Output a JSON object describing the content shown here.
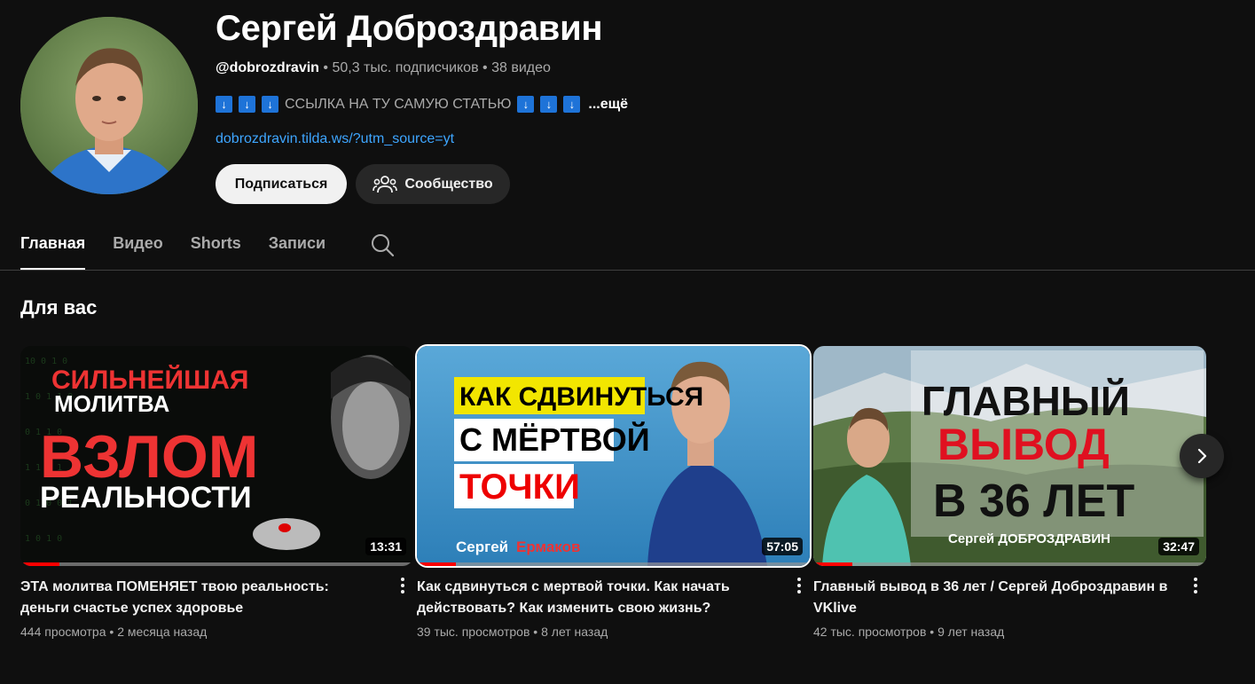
{
  "channel": {
    "name": "Сергей Доброздравин",
    "handle": "@dobrozdravin",
    "subscribers": "50,3 тыс. подписчиков",
    "videos_count": "38 видео",
    "description": "ССЫЛКА НА ТУ САМУЮ СТАТЬЮ",
    "arrow_glyph": "↓",
    "more_label": "...ещё",
    "link": "dobrozdravin.tilda.ws/?utm_source=yt",
    "subscribe_label": "Подписаться",
    "community_label": "Сообщество"
  },
  "tabs": [
    {
      "label": "Главная",
      "active": true
    },
    {
      "label": "Видео"
    },
    {
      "label": "Shorts"
    },
    {
      "label": "Записи"
    }
  ],
  "section": {
    "title": "Для вас"
  },
  "videos": [
    {
      "title": "ЭТА молитва ПОМЕНЯЕТ твою реальность: деньги счастье успех здоровье",
      "views": "444 просмотра",
      "age": "2 месяца назад",
      "duration": "13:31",
      "progress": 0.1,
      "thumb_lines": [
        "СИЛЬНЕЙШАЯ",
        "МОЛИТВА",
        "ВЗЛОМ",
        "РЕАЛЬНОСТИ"
      ]
    },
    {
      "title": "Как сдвинуться с мертвой точки. Как начать действовать? Как изменить свою жизнь?",
      "views": "39 тыс. просмотров",
      "age": "8 лет назад",
      "duration": "57:05",
      "progress": 0.1,
      "thumb_lines": [
        "КАК СДВИНУТЬСЯ",
        "С МЁРТВОЙ",
        "ТОЧКИ",
        "Сергей",
        "Ермаков"
      ]
    },
    {
      "title": "Главный вывод в 36 лет / Сергей Доброздравин в VKlive",
      "views": "42 тыс. просмотров",
      "age": "9 лет назад",
      "duration": "32:47",
      "progress": 0.1,
      "thumb_lines": [
        "ГЛАВНЫЙ",
        "ВЫВОД",
        "В 36 ЛЕТ",
        "Сергей ДОБРОЗДРАВИН"
      ]
    }
  ],
  "meta_separator": "•",
  "colors": {
    "accent_link": "#3ea6ff",
    "progress": "#ff0000",
    "background": "#0f0f0f"
  }
}
